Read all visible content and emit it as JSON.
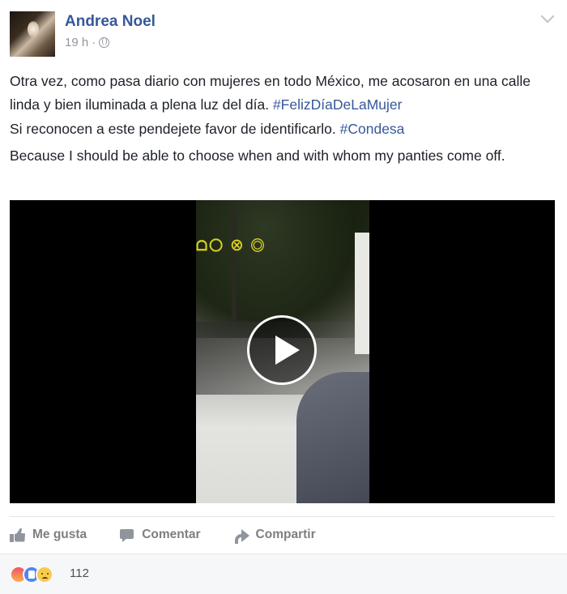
{
  "post": {
    "author": "Andrea Noel",
    "time": "19 h",
    "separator": "·",
    "paragraphs": [
      {
        "text": "Otra vez, como pasa diario con mujeres en todo México, me acosaron en una calle linda y bien iluminada a plena luz del día. ",
        "hashtag": "#FelizDíaDeLaMujer"
      },
      {
        "text": "Si reconocen a este pendejete favor de identificarlo. ",
        "hashtag": "#Condesa"
      },
      {
        "text": "Because I should be able to choose when and with whom my panties come off.",
        "hashtag": ""
      }
    ],
    "video_overlay_text": "ᗝ〇  ⊗ ◎"
  },
  "actions": {
    "like": "Me gusta",
    "comment": "Comentar",
    "share": "Compartir"
  },
  "reactions": {
    "count": "112",
    "types": [
      "angry-icon",
      "like-icon",
      "sad-icon"
    ]
  },
  "colors": {
    "link": "#365899",
    "text": "#1d2129",
    "muted": "#90949c",
    "action": "#7f7f7f"
  }
}
